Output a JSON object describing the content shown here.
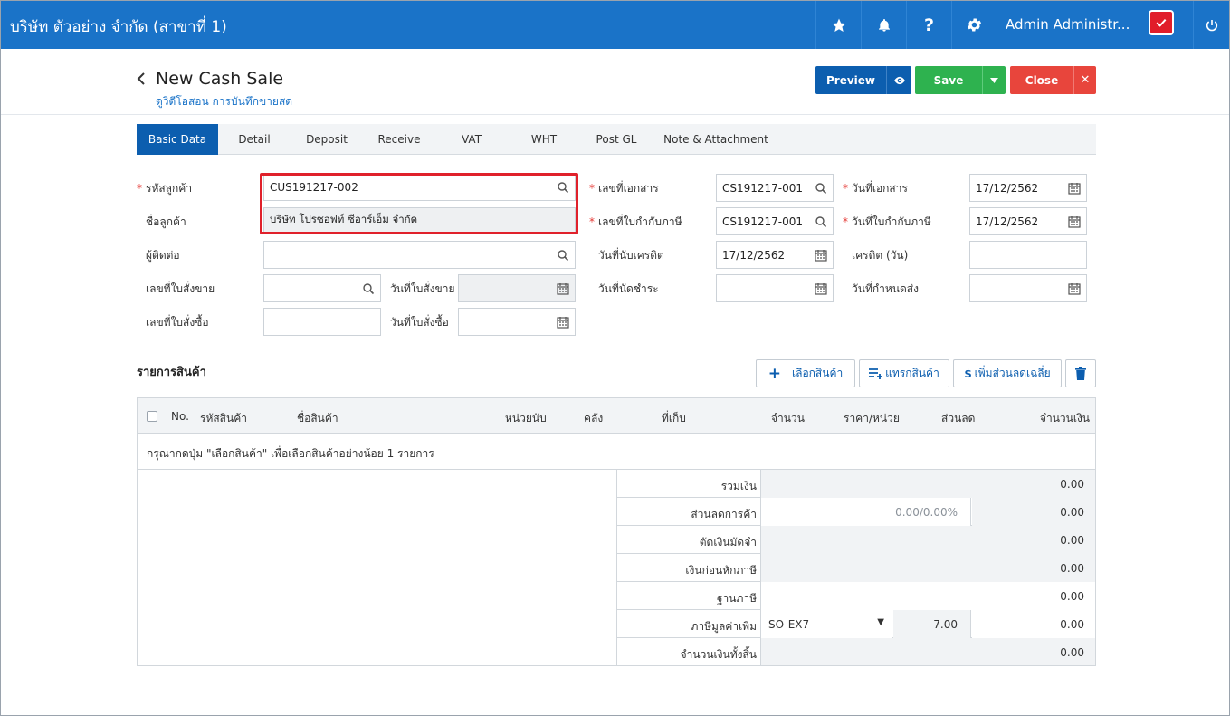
{
  "app": {
    "title": "บริษัท ตัวอย่าง จำกัด (สาขาที่ 1)",
    "user": "Admin Administr..."
  },
  "header": {
    "title": "New Cash Sale",
    "subtitle": "ดูวิดีโอสอน การบันทึกขายสด"
  },
  "actions": {
    "preview": "Preview",
    "save": "Save",
    "close": "Close"
  },
  "tabs": [
    "Basic Data",
    "Detail",
    "Deposit",
    "Receive",
    "VAT",
    "WHT",
    "Post GL",
    "Note & Attachment"
  ],
  "form": {
    "customer_code_label": "รหัสลูกค้า",
    "customer_code": "CUS191217-002",
    "customer_name_label": "ชื่อลูกค้า",
    "customer_name": "บริษัท โปรซอฟท์ ซีอาร์เอ็ม จำกัด",
    "contact_label": "ผู้ติดต่อ",
    "contact": "",
    "sales_order_no_label": "เลขที่ใบสั่งขาย",
    "sales_order_no": "",
    "sales_order_date_label": "วันที่ใบสั่งขาย",
    "sales_order_date": "",
    "purchase_order_no_label": "เลขที่ใบสั่งซื้อ",
    "purchase_order_no": "",
    "purchase_order_date_label": "วันที่ใบสั่งซื้อ",
    "purchase_order_date": "",
    "doc_no_label": "เลขที่เอกสาร",
    "doc_no": "CS191217-001",
    "tax_invoice_no_label": "เลขที่ใบกำกับภาษี",
    "tax_invoice_no": "CS191217-001",
    "credit_start_date_label": "วันที่นับเครดิต",
    "credit_start_date": "17/12/2562",
    "due_date_label": "วันที่นัดชำระ",
    "due_date": "",
    "doc_date_label": "วันที่เอกสาร",
    "doc_date": "17/12/2562",
    "tax_invoice_date_label": "วันที่ใบกำกับภาษี",
    "tax_invoice_date": "17/12/2562",
    "credit_days_label": "เครดิต (วัน)",
    "credit_days": "",
    "delivery_date_label": "วันที่กำหนดส่ง",
    "delivery_date": ""
  },
  "products": {
    "section_title": "รายการสินค้า",
    "select_button": "เลือกสินค้า",
    "insert_button": "แทรกสินค้า",
    "discount_button": "เพิ่มส่วนลดเฉลี่ย",
    "columns": [
      "No.",
      "รหัสสินค้า",
      "ชื่อสินค้า",
      "หน่วยนับ",
      "คลัง",
      "ที่เก็บ",
      "จำนวน",
      "ราคา/หน่วย",
      "ส่วนลด",
      "จำนวนเงิน"
    ],
    "empty_message": "กรุณากดปุ่ม \"เลือกสินค้า\" เพื่อเลือกสินค้าอย่างน้อย 1 รายการ"
  },
  "summary": {
    "subtotal_label": "รวมเงิน",
    "subtotal": "0.00",
    "trade_discount_label": "ส่วนลดการค้า",
    "trade_discount_input": "0.00/0.00%",
    "trade_discount": "0.00",
    "deposit_label": "ตัดเงินมัดจำ",
    "deposit": "0.00",
    "before_tax_label": "เงินก่อนหักภาษี",
    "before_tax": "0.00",
    "tax_base_label": "ฐานภาษี",
    "tax_base": "0.00",
    "vat_label": "ภาษีมูลค่าเพิ่ม",
    "vat_code": "SO-EX7",
    "vat_rate": "7.00",
    "vat": "0.00",
    "grand_total_label": "จำนวนเงินทั้งสิ้น",
    "grand_total": "0.00"
  },
  "colors": {
    "topbar": "#1a73c8",
    "primary": "#0c5eaf",
    "save": "#2eb24f",
    "close": "#e8453c",
    "highlight": "#e0212b"
  }
}
